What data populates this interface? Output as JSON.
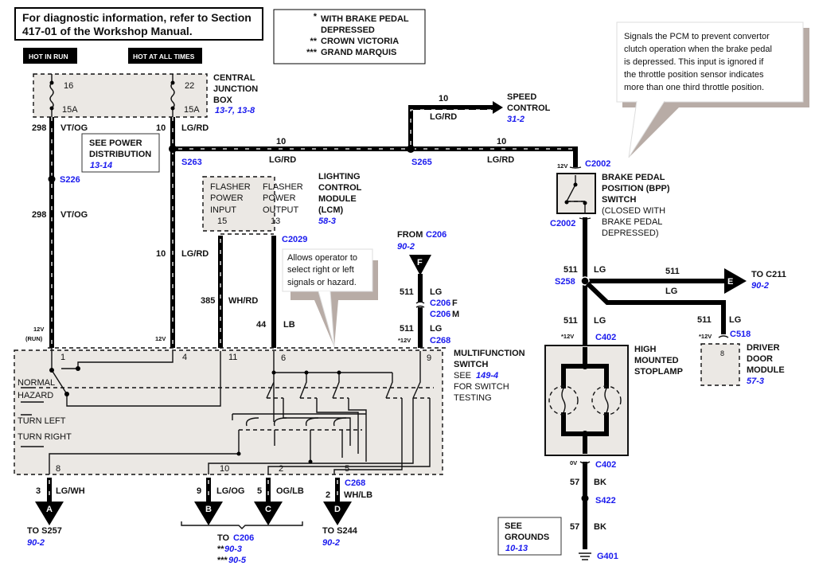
{
  "note": {
    "line1": "For diagnostic information, refer to Section",
    "line2": "417-01 of the Workshop Manual."
  },
  "legend": [
    {
      "mark": "*",
      "text": "WITH BRAKE PEDAL"
    },
    {
      "mark": "",
      "text": "DEPRESSED"
    },
    {
      "mark": "**",
      "text": "CROWN VICTORIA"
    },
    {
      "mark": "***",
      "text": "GRAND MARQUIS"
    }
  ],
  "power": {
    "hot_in_run": "HOT IN RUN",
    "hot_at_all_times": "HOT AT ALL TIMES"
  },
  "cjb": {
    "fuse1": "16",
    "fuse1_amp": "15A",
    "fuse2": "22",
    "fuse2_amp": "15A",
    "name": [
      "CENTRAL",
      "JUNCTION",
      "BOX"
    ],
    "ref": "13-7,  13-8"
  },
  "power_dist": {
    "lines": [
      "SEE POWER",
      "DISTRIBUTION"
    ],
    "ref": "13-14"
  },
  "wires": {
    "w298": {
      "circuit": "298",
      "color": "VT/OG"
    },
    "w10": {
      "circuit": "10",
      "color": "LG/RD"
    },
    "w385": {
      "circuit": "385",
      "color": "WH/RD"
    },
    "w44": {
      "circuit": "44",
      "color": "LB"
    },
    "w511": {
      "circuit": "511",
      "color": "LG"
    },
    "w57": {
      "circuit": "57",
      "color": "BK"
    },
    "w3": {
      "circuit": "3",
      "color": "LG/WH"
    },
    "w9": {
      "circuit": "9",
      "color": "LG/OG"
    },
    "w5": {
      "circuit": "5",
      "color": "OG/LB"
    },
    "w2": {
      "circuit": "2",
      "color": "WH/LB"
    }
  },
  "splices": {
    "s226": "S226",
    "s263": "S263",
    "s265": "S265",
    "s258": "S258",
    "s422": "S422",
    "g401": "G401"
  },
  "speed_control": {
    "lines": [
      "SPEED",
      "CONTROL"
    ],
    "ref": "31-2"
  },
  "bpp": {
    "connector_top": "C2002",
    "connector_bottom": "C2002",
    "voltage": "12V",
    "lines": [
      "BRAKE PEDAL",
      "POSITION (BPP)",
      "SWITCH"
    ],
    "note": [
      "(CLOSED WITH",
      "BRAKE PEDAL",
      "DEPRESSED)"
    ]
  },
  "callout_pcm": [
    "Signals the PCM to prevent convertor",
    "clutch operation when the brake pedal",
    "is depressed.  This input is ignored if",
    "the throttle position sensor indicates",
    "more than one third throttle position."
  ],
  "lcm": {
    "col1": [
      "FLASHER",
      "POWER",
      "INPUT",
      "15"
    ],
    "col2": [
      "FLASHER",
      "POWER",
      "OUTPUT",
      "13"
    ],
    "name": [
      "LIGHTING",
      "CONTROL",
      "MODULE",
      "(LCM)"
    ],
    "ref": "58-3",
    "connector": "C2029"
  },
  "callout_mfs": [
    "Allows operator to",
    "select right or left",
    "signals or hazard."
  ],
  "from_c206": {
    "from": "FROM ",
    "connector": "C206",
    "ref": "90-2",
    "letter": "F",
    "c206f": "C206",
    "f": "F",
    "c206m": "C206",
    "m": "M",
    "voltage": "*12V",
    "c268": "C268"
  },
  "mfs": {
    "name": [
      "MULTIFUNCTION",
      "SWITCH"
    ],
    "see": "SEE ",
    "ref": "149-4",
    "lines": [
      "FOR SWITCH",
      "TESTING"
    ],
    "v1": "12V",
    "v1b": "(RUN)",
    "v4": "12V",
    "pins": {
      "p1": "1",
      "p4": "4",
      "p11": "11",
      "p6": "6",
      "p9": "9",
      "p8": "8",
      "p10": "10",
      "p2": "2",
      "p5": "5"
    },
    "positions": [
      "NORMAL",
      "HAZARD",
      "TURN LEFT",
      "TURN RIGHT"
    ]
  },
  "outputs": {
    "a": {
      "letter": "A",
      "to": "TO S257",
      "ref": "90-2"
    },
    "b": {
      "letter": "B"
    },
    "c": {
      "letter": "C"
    },
    "d": {
      "letter": "D",
      "to": "TO S244",
      "ref": "90-2",
      "connector": "C268"
    },
    "bc": {
      "to": "TO ",
      "connector": "C206",
      "ref1_mark": "**",
      "ref1": "90-3",
      "ref2_mark": "***",
      "ref2": "90-5"
    }
  },
  "e_out": {
    "letter": "E",
    "to": "TO C211",
    "ref": "90-2"
  },
  "hms": {
    "connector_top": "C402",
    "voltage_top": "*12V",
    "connector_bottom": "C402",
    "voltage_bottom": "0V",
    "name": [
      "HIGH",
      "MOUNTED",
      "STOPLAMP"
    ]
  },
  "ddm": {
    "connector": "C518",
    "voltage": "*12V",
    "pin": "8",
    "name": [
      "DRIVER",
      "DOOR",
      "MODULE"
    ],
    "ref": "57-3"
  },
  "grounds": {
    "lines": [
      "SEE",
      "GROUNDS"
    ],
    "ref": "10-13"
  },
  "colors": {
    "link": "#1a1aee",
    "component_fill": "#ebe8e4",
    "callout_shadow": "#b8aca6",
    "wire": "#000000"
  }
}
